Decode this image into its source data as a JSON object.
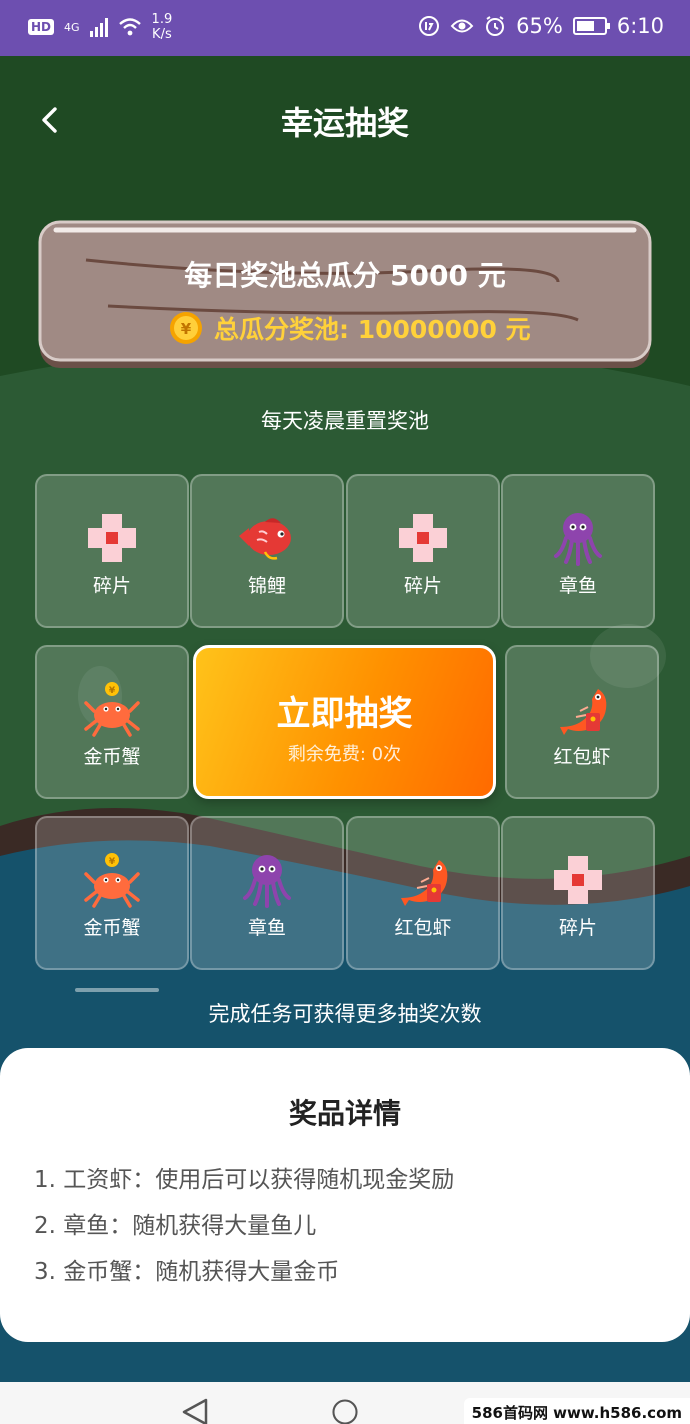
{
  "status_bar": {
    "hd": "HD",
    "network": "4G",
    "speed_value": "1.9",
    "speed_unit": "K/s",
    "battery": "65%",
    "battery_level": 0.65,
    "time": "6:10"
  },
  "header": {
    "title": "幸运抽奖"
  },
  "pool": {
    "daily": "每日奖池总瓜分 5000 元",
    "total": "总瓜分奖池: 10000000 元",
    "reset_note": "每天凌晨重置奖池"
  },
  "grid": {
    "cells": [
      {
        "label": "碎片",
        "icon": "fragment-icon"
      },
      {
        "label": "锦鲤",
        "icon": "koi-fish-icon"
      },
      {
        "label": "碎片",
        "icon": "fragment-icon"
      },
      {
        "label": "章鱼",
        "icon": "octopus-icon"
      },
      {
        "label": "金币蟹",
        "icon": "gold-crab-icon"
      },
      {
        "label": "红包虾",
        "icon": "red-envelope-shrimp-icon"
      },
      {
        "label": "金币蟹",
        "icon": "gold-crab-icon"
      },
      {
        "label": "章鱼",
        "icon": "octopus-icon"
      },
      {
        "label": "红包虾",
        "icon": "red-envelope-shrimp-icon"
      },
      {
        "label": "碎片",
        "icon": "fragment-icon"
      }
    ],
    "draw_button": {
      "title": "立即抽奖",
      "remaining": "剩余免费: 0次"
    }
  },
  "task_note": "完成任务可获得更多抽奖次数",
  "details": {
    "title": "奖品详情",
    "items": [
      "1. 工资虾：使用后可以获得随机现金奖励",
      "2. 章鱼：随机获得大量鱼儿",
      "3. 金币蟹：随机获得大量金币"
    ]
  },
  "watermark": "586首码网 www.h586.com",
  "colors": {
    "status_bar": "#6d4fb0",
    "forest": "#1f4a23",
    "hill": "#2c5a34",
    "sea": "#13506a",
    "draw_button": "#ff9100",
    "gold_text": "#ffd13a"
  }
}
